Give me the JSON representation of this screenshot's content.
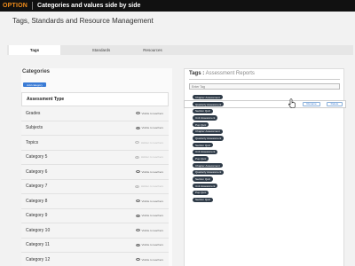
{
  "topbar": {
    "option": "OPTION",
    "title": "Categories and values side by side"
  },
  "page": {
    "title": "Tags, Standards and Resource Management"
  },
  "tabs": [
    {
      "label": "Tags",
      "active": true
    },
    {
      "label": "Standards",
      "active": false
    },
    {
      "label": "Resources",
      "active": false
    }
  ],
  "categories": {
    "heading": "Categories",
    "add_label": "Add category",
    "rows": [
      {
        "label": "Assessment Type",
        "selected": true,
        "visibility": ""
      },
      {
        "label": "Grades",
        "visibility": "Visible to teachers",
        "visible": true
      },
      {
        "label": "Subjects",
        "visibility": "Visible to teachers",
        "visible": true
      },
      {
        "label": "Topics",
        "visibility": "Hidden to teachers",
        "visible": false
      },
      {
        "label": "Category 5",
        "visibility": "Hidden to teachers",
        "visible": false
      },
      {
        "label": "Category 6",
        "visibility": "Visible to teachers",
        "visible": true
      },
      {
        "label": "Category 7",
        "visibility": "Hidden to teachers",
        "visible": false
      },
      {
        "label": "Category 8",
        "visibility": "Visible to teachers",
        "visible": true
      },
      {
        "label": "Category 9",
        "visibility": "Visible to teachers",
        "visible": true
      },
      {
        "label": "Category 10",
        "visibility": "Visible to teachers",
        "visible": true
      },
      {
        "label": "Category 11",
        "visibility": "Visible to teachers",
        "visible": true
      },
      {
        "label": "Category 12",
        "visibility": "Visible to teachers",
        "visible": true
      }
    ]
  },
  "tags": {
    "heading_key": "Tags :",
    "heading_value": "Assessment Reports",
    "input_placeholder": "Enter Tag",
    "rename_label": "Rename",
    "delete_label": "Delete",
    "items": [
      "Chapter Assessment",
      "Quarterly Assessment",
      "Section Quiz",
      "Unit Assessment",
      "Pop Quiz",
      "Chapter Assessment",
      "Quarterly Assessment",
      "Section Quiz",
      "Unit Assessment",
      "Pop Quiz",
      "Chapter Assessment",
      "Quarterly Assessment",
      "Section Quiz",
      "Unit Assessment",
      "Pop Quiz",
      "Section Quiz"
    ],
    "highlighted_index": 1
  }
}
